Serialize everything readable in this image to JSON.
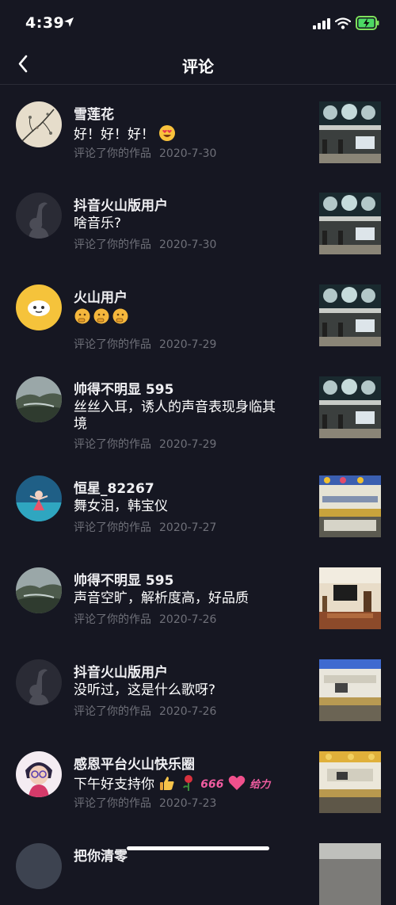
{
  "status": {
    "time": "4:39"
  },
  "header": {
    "title": "评论"
  },
  "comments": [
    {
      "user": "雪莲花",
      "text": "好！好！好！",
      "action": "评论了你的作品",
      "date": "2020-7-30"
    },
    {
      "user": "抖音火山版用户",
      "text": "啥音乐?",
      "action": "评论了你的作品",
      "date": "2020-7-30"
    },
    {
      "user": "火山用户",
      "text": "",
      "action": "评论了你的作品",
      "date": "2020-7-29"
    },
    {
      "user": "帅得不明显 595",
      "text": "丝丝入耳，诱人的声音表现身临其境",
      "action": "评论了你的作品",
      "date": "2020-7-29"
    },
    {
      "user": "恒星_82267",
      "text": "舞女泪，韩宝仪",
      "action": "评论了你的作品",
      "date": "2020-7-27"
    },
    {
      "user": "帅得不明显 595",
      "text": "声音空旷，解析度高，好品质",
      "action": "评论了你的作品",
      "date": "2020-7-26"
    },
    {
      "user": "抖音火山版用户",
      "text": "没听过，这是什么歌呀?",
      "action": "评论了你的作品",
      "date": "2020-7-26"
    },
    {
      "user": "感恩平台火山快乐圈",
      "text": "下午好支持你",
      "sticker_text": "666",
      "sticker_text2": "给力",
      "action": "评论了你的作品",
      "date": "2020-7-23"
    },
    {
      "user": "把你清零",
      "text": "",
      "action": "",
      "date": ""
    }
  ]
}
